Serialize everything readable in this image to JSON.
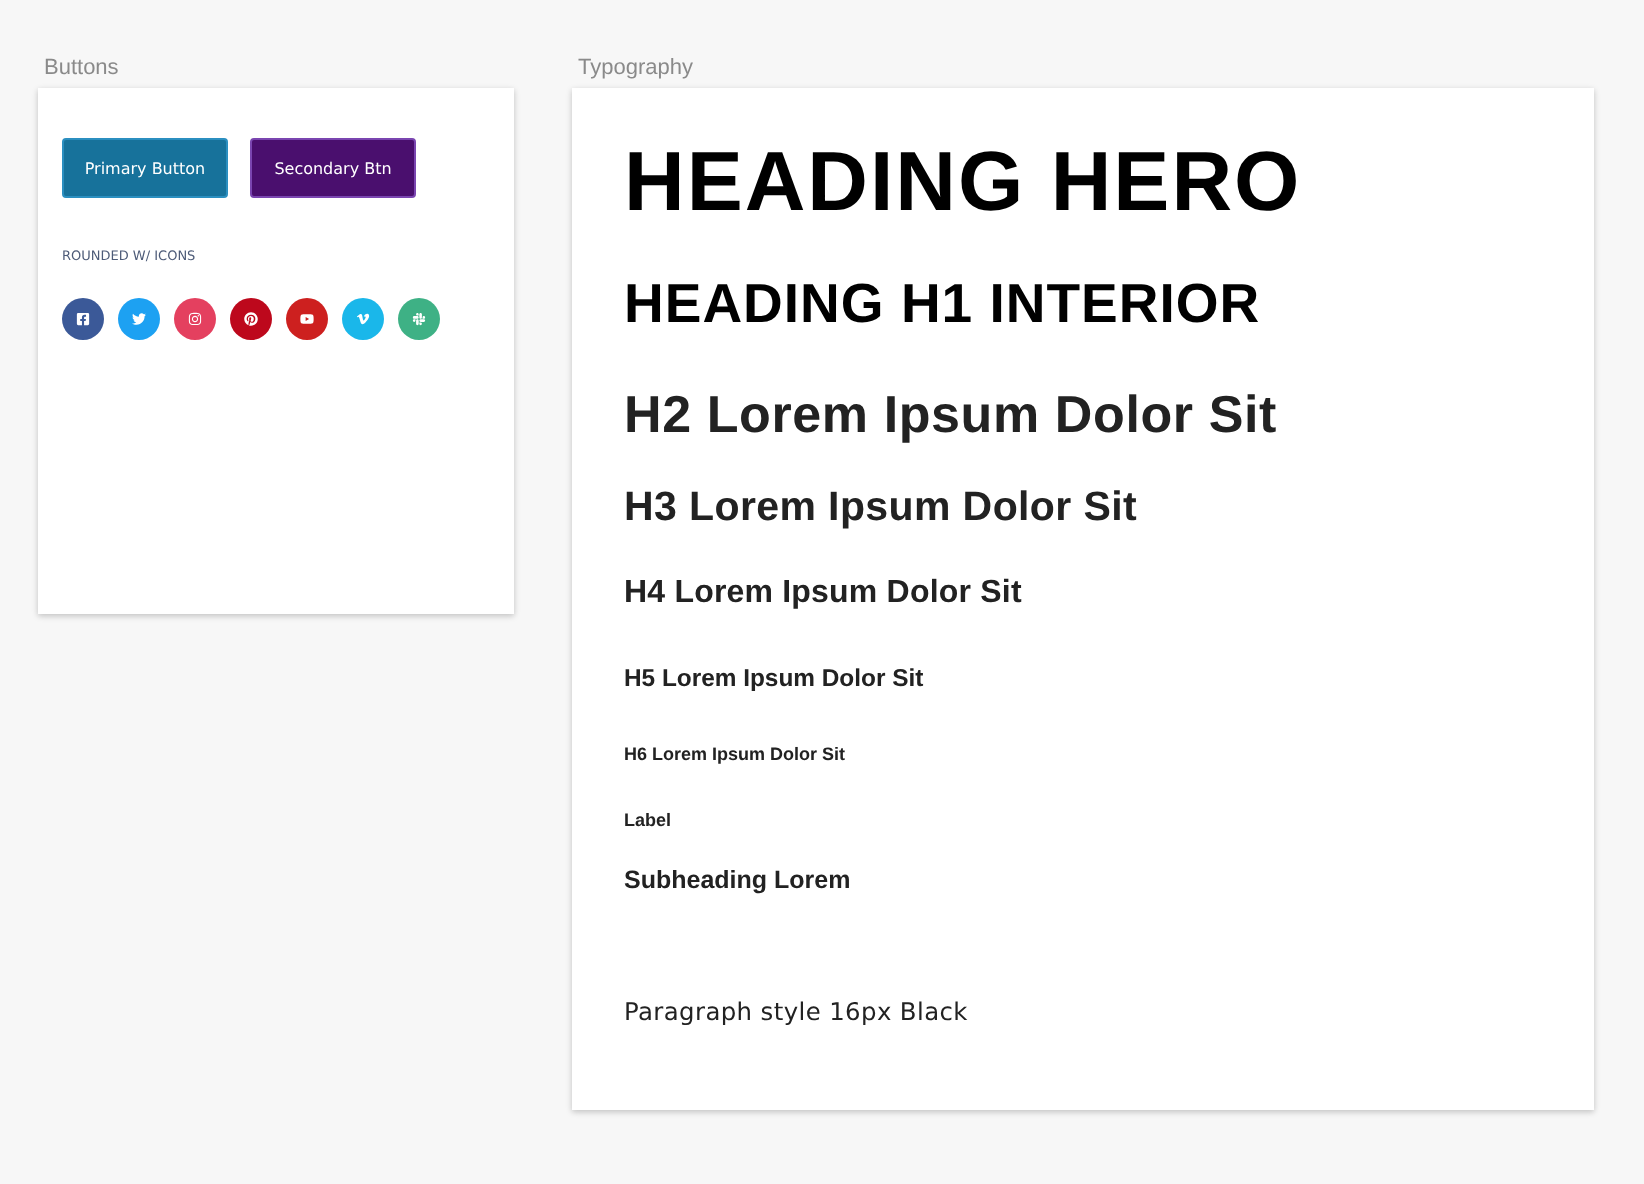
{
  "buttons_panel": {
    "title": "Buttons",
    "buttons": [
      {
        "label": "Primary Button",
        "kind": "primary"
      },
      {
        "label": "Secondary Btn",
        "kind": "secondary"
      }
    ],
    "social_heading": "ROUNDED W/ ICONS",
    "social_buttons": [
      {
        "kind": "facebook",
        "color": "#3b5998"
      },
      {
        "kind": "twitter",
        "color": "#1da1f2"
      },
      {
        "kind": "instagram",
        "color": "#e4405f"
      },
      {
        "kind": "pinterest",
        "color": "#bd081c"
      },
      {
        "kind": "youtube",
        "color": "#cd201f"
      },
      {
        "kind": "vimeo",
        "color": "#1ab7ea"
      },
      {
        "kind": "slack",
        "color": "#3eb185"
      }
    ]
  },
  "typography_panel": {
    "title": "Typography",
    "styles": [
      {
        "kind": "hero",
        "text": "HEADING HERO"
      },
      {
        "kind": "h1",
        "text": "HEADING H1 INTERIOR"
      },
      {
        "kind": "h2",
        "text": "H2 Lorem Ipsum Dolor Sit"
      },
      {
        "kind": "h3",
        "text": "H3 Lorem Ipsum Dolor Sit"
      },
      {
        "kind": "h4",
        "text": "H4 Lorem Ipsum Dolor Sit"
      },
      {
        "kind": "h5",
        "text": "H5 Lorem Ipsum Dolor Sit"
      },
      {
        "kind": "h6",
        "text": "H6 Lorem Ipsum Dolor Sit"
      },
      {
        "kind": "label",
        "text": "Label"
      },
      {
        "kind": "subheading",
        "text": "Subheading Lorem"
      },
      {
        "kind": "paragraph",
        "text": "Paragraph style 16px Black"
      }
    ]
  }
}
